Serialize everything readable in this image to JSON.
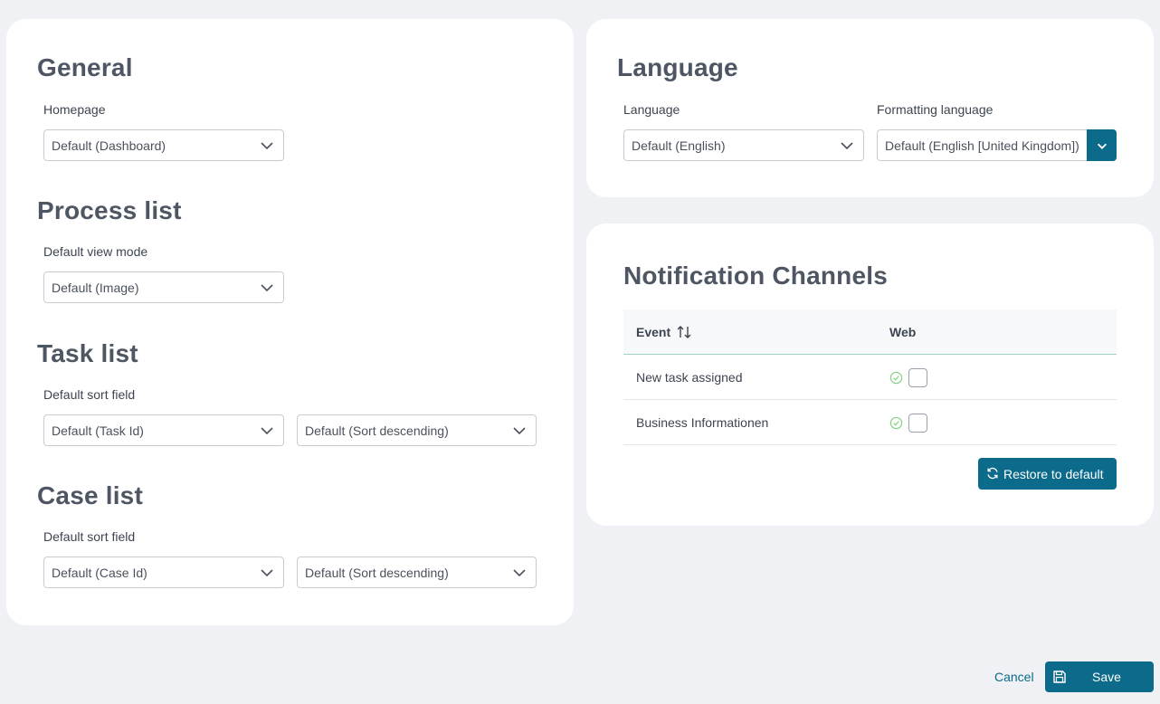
{
  "general": {
    "title": "General",
    "homepage_label": "Homepage",
    "homepage_value": "Default (Dashboard)"
  },
  "process_list": {
    "title": "Process list",
    "view_mode_label": "Default view mode",
    "view_mode_value": "Default (Image)"
  },
  "task_list": {
    "title": "Task list",
    "sort_field_label": "Default sort field",
    "sort_field_value": "Default (Task Id)",
    "sort_order_value": "Default (Sort descending)"
  },
  "case_list": {
    "title": "Case list",
    "sort_field_label": "Default sort field",
    "sort_field_value": "Default (Case Id)",
    "sort_order_value": "Default (Sort descending)"
  },
  "language": {
    "title": "Language",
    "language_label": "Language",
    "language_value": "Default (English)",
    "formatting_label": "Formatting language",
    "formatting_value": "Default (English [United Kingdom])"
  },
  "notifications": {
    "title": "Notification Channels",
    "columns": [
      "Event",
      "Web"
    ],
    "rows": [
      {
        "event": "New task assigned",
        "web_default": true,
        "web_checked": false
      },
      {
        "event": "Business Informationen",
        "web_default": true,
        "web_checked": false
      }
    ],
    "restore_label": "Restore to default"
  },
  "footer": {
    "cancel_label": "Cancel",
    "save_label": "Save"
  },
  "colors": {
    "accent": "#0c6a8a",
    "background": "#eff1f4",
    "card": "#ffffff",
    "success": "#7fcf7f"
  }
}
